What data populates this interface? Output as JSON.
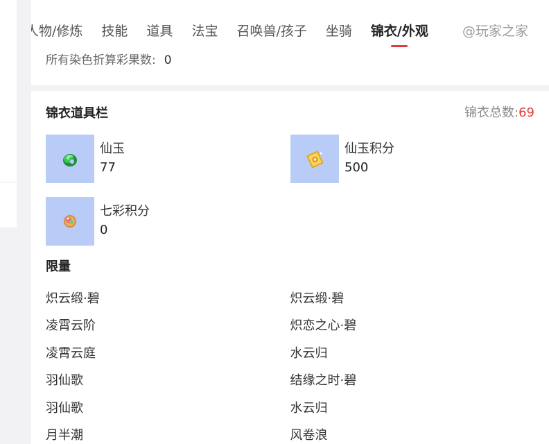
{
  "tabs": [
    {
      "label": "人物/修炼"
    },
    {
      "label": "技能"
    },
    {
      "label": "道具"
    },
    {
      "label": "法宝"
    },
    {
      "label": "召唤兽/孩子"
    },
    {
      "label": "坐骑"
    },
    {
      "label": "锦衣/外观"
    }
  ],
  "watermark": "@玩家之家",
  "dye": {
    "label": "所有染色折算彩果数:",
    "value": "0"
  },
  "jinyi": {
    "title": "锦衣道具栏",
    "total_label": "锦衣总数:",
    "total_value": "69",
    "items": [
      {
        "name": "仙玉",
        "qty": "77",
        "icon": "jade-icon"
      },
      {
        "name": "仙玉积分",
        "qty": "500",
        "icon": "jade-points-icon"
      },
      {
        "name": "七彩积分",
        "qty": "0",
        "icon": "rainbow-points-icon"
      }
    ]
  },
  "limited": {
    "title": "限量",
    "rows": [
      [
        "炽云缎·碧",
        "炽云缎·碧"
      ],
      [
        "凌霄云阶",
        "炽恋之心·碧"
      ],
      [
        "凌霄云庭",
        "水云归"
      ],
      [
        "羽仙歌",
        "结缘之时·碧"
      ],
      [
        "羽仙歌",
        "水云归"
      ],
      [
        "月半潮",
        "风卷浪"
      ]
    ]
  },
  "colors": {
    "accent_red": "#e43a3a",
    "thumb_bg": "#b9ccf7"
  }
}
